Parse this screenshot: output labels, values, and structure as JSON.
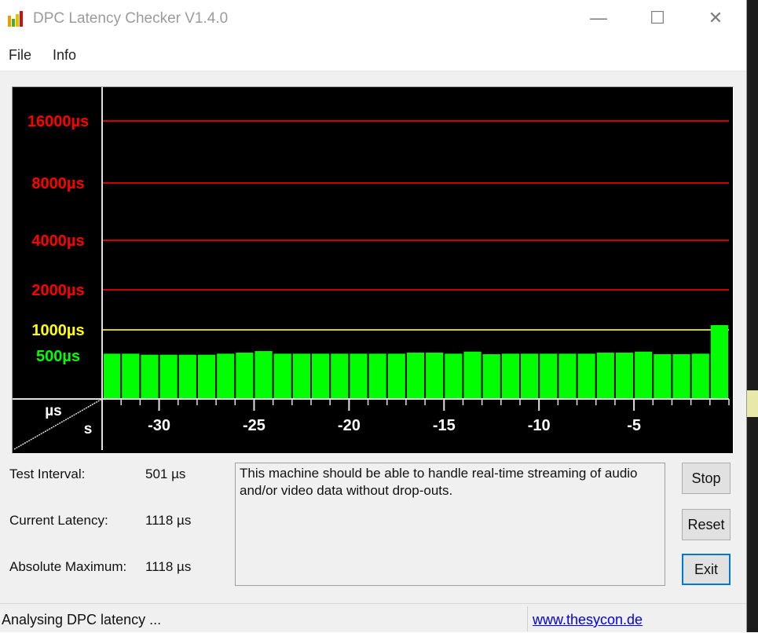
{
  "window": {
    "title": "DPC Latency Checker V1.4.0",
    "controls": {
      "minimize": "—",
      "maximize": "☐",
      "close": "✕"
    }
  },
  "menu": [
    {
      "label": "File"
    },
    {
      "label": "Info"
    }
  ],
  "chart_data": {
    "type": "bar",
    "title": "",
    "xlabel": "s",
    "ylabel": "µs",
    "x_tick_labels": [
      "-30",
      "-25",
      "-20",
      "-15",
      "-10",
      "-5"
    ],
    "y_reference_lines": [
      {
        "label": "16000µs",
        "value": 16000,
        "color": "#ff0000"
      },
      {
        "label": "8000µs",
        "value": 8000,
        "color": "#ff0000"
      },
      {
        "label": "4000µs",
        "value": 4000,
        "color": "#ff0000"
      },
      {
        "label": "2000µs",
        "value": 2000,
        "color": "#ff0000"
      },
      {
        "label": "1000µs",
        "value": 1000,
        "color": "#ffff00"
      },
      {
        "label": "500µs",
        "value": 500,
        "color": "#00ff00",
        "line": false
      }
    ],
    "x": [
      -32,
      -31,
      -30,
      -29,
      -28,
      -27,
      -26,
      -25,
      -24,
      -23,
      -22,
      -21,
      -20,
      -19,
      -18,
      -17,
      -16,
      -15,
      -14,
      -13,
      -12,
      -11,
      -10,
      -9,
      -8,
      -7,
      -6,
      -5,
      -4,
      -3,
      -2,
      -1,
      0
    ],
    "values": [
      540,
      540,
      520,
      520,
      520,
      520,
      540,
      560,
      590,
      540,
      540,
      540,
      540,
      540,
      540,
      540,
      560,
      560,
      540,
      580,
      530,
      540,
      540,
      540,
      540,
      540,
      560,
      560,
      580,
      530,
      530,
      540,
      1118
    ],
    "bar_color": "#00ff00",
    "xlim": [
      -33,
      0
    ],
    "y_scale": "piecewise-log"
  },
  "stats": [
    {
      "label": "Test Interval:",
      "value": "501 µs"
    },
    {
      "label": "Current Latency:",
      "value": "1118 µs"
    },
    {
      "label": "Absolute Maximum:",
      "value": "1118 µs"
    }
  ],
  "message": "This machine should be able to handle real-time streaming of audio and/or video data without drop-outs.",
  "buttons": {
    "stop": "Stop",
    "reset": "Reset",
    "exit": "Exit"
  },
  "status": {
    "text": "Analysing DPC latency ...",
    "link": "www.thesycon.de"
  }
}
